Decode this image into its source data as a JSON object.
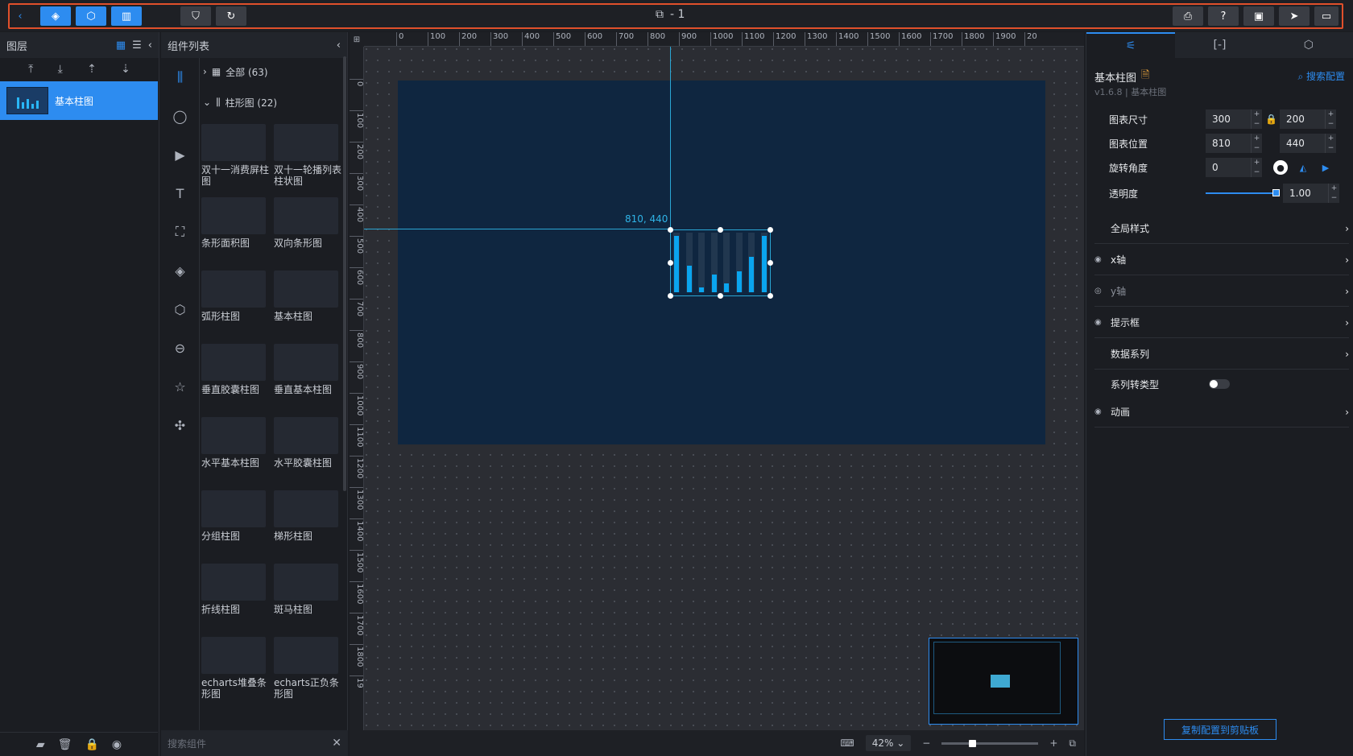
{
  "toolbar": {
    "back_icon": "chevron-left-icon",
    "layers_icon": "layers-icon",
    "components_icon": "cube-icon",
    "config_icon": "panel-icon",
    "filter_icon": "filter-icon",
    "refresh_icon": "refresh-icon",
    "page_icon": "copy-icon",
    "page_title": "- 1",
    "right_icons": [
      "preview-icon",
      "help-icon",
      "save-icon",
      "publish-icon",
      "screen-icon"
    ]
  },
  "layers": {
    "title": "图层",
    "items": [
      {
        "label": "基本柱图"
      }
    ]
  },
  "components": {
    "title": "组件列表",
    "all_label": "全部 (63)",
    "bar_label": "柱形图 (22)",
    "cards": [
      {
        "label": "双十一消费屏柱图"
      },
      {
        "label": "双十一轮播列表柱状图"
      },
      {
        "label": "条形面积图"
      },
      {
        "label": "双向条形图"
      },
      {
        "label": "弧形柱图"
      },
      {
        "label": "基本柱图"
      },
      {
        "label": "垂直胶囊柱图"
      },
      {
        "label": "垂直基本柱图"
      },
      {
        "label": "水平基本柱图"
      },
      {
        "label": "水平胶囊柱图"
      },
      {
        "label": "分组柱图"
      },
      {
        "label": "梯形柱图"
      },
      {
        "label": "折线柱图"
      },
      {
        "label": "斑马柱图"
      },
      {
        "label": "echarts堆叠条形图"
      },
      {
        "label": "echarts正负条形图"
      }
    ],
    "search_placeholder": "搜索组件"
  },
  "canvas": {
    "ruler_h": [
      "0",
      "100",
      "200",
      "300",
      "400",
      "500",
      "600",
      "700",
      "800",
      "900",
      "1000",
      "1100",
      "1200",
      "1300",
      "1400",
      "1500",
      "1600",
      "1700",
      "1800",
      "1900",
      "20"
    ],
    "ruler_v": [
      "0",
      "100",
      "200",
      "300",
      "400",
      "500",
      "600",
      "700",
      "800",
      "900",
      "1000",
      "1100",
      "1200",
      "1300",
      "1400",
      "1500",
      "1600",
      "1700",
      "1800",
      "19"
    ],
    "selection_coord": "810, 440",
    "chart_values": [
      0.95,
      0.45,
      0.08,
      0.3,
      0.15,
      0.35,
      0.6,
      0.95
    ]
  },
  "status": {
    "zoom": "42%",
    "zoom_level": 0.3
  },
  "config": {
    "tabs": [
      "sliders-icon",
      "bracket-icon",
      "link-icon"
    ],
    "comp_name": "基本柱图",
    "comp_version": "v1.6.8 | 基本柱图",
    "search_config": "搜索配置",
    "size_label": "图表尺寸",
    "width": "300",
    "height": "200",
    "pos_label": "图表位置",
    "pos_x": "810",
    "pos_y": "440",
    "rotate_label": "旋转角度",
    "rotate": "0",
    "opacity_label": "透明度",
    "opacity": "1.00",
    "sections": [
      {
        "label": "全局样式",
        "eye": false
      },
      {
        "label": "x轴",
        "eye": true
      },
      {
        "label": "y轴",
        "eye": true
      },
      {
        "label": "提示框",
        "eye": true
      },
      {
        "label": "数据系列",
        "eye": false
      }
    ],
    "series_type_label": "系列转类型",
    "animation_label": "动画",
    "copy_button": "复制配置到剪贴板"
  }
}
